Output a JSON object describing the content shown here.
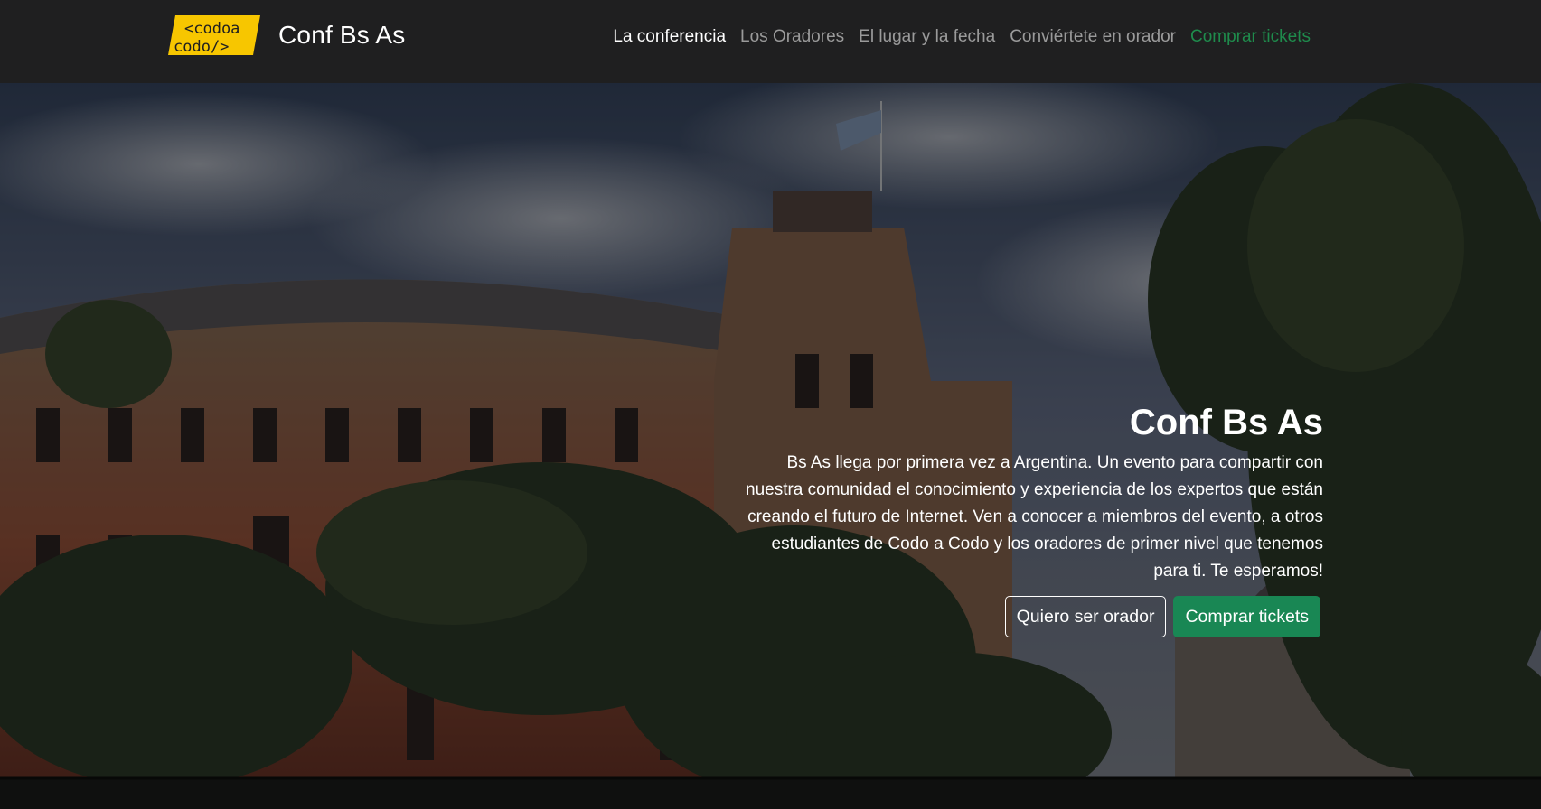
{
  "brand": {
    "logo_line1": "<codoa",
    "logo_line2": "codo/>",
    "name": "Conf Bs As",
    "logo_color": "#f7c600"
  },
  "nav": {
    "items": [
      {
        "label": "La conferencia",
        "state": "active"
      },
      {
        "label": "Los Oradores"
      },
      {
        "label": "El lugar y la fecha"
      },
      {
        "label": "Conviértete en orador"
      },
      {
        "label": "Comprar tickets",
        "color": "#1f8b4c"
      }
    ]
  },
  "hero": {
    "title": "Conf Bs As",
    "text": "Bs As llega por primera vez a Argentina. Un evento para compartir con nuestra comunidad el conocimiento y experiencia de los expertos que están creando el futuro de Internet. Ven a conocer a miembros del evento, a otros estudiantes de Codo a Codo y los oradores de primer nivel que tenemos para ti. Te esperamos!",
    "button_outline": "Quiero ser orador",
    "button_primary": "Comprar tickets",
    "primary_color": "#198754"
  }
}
